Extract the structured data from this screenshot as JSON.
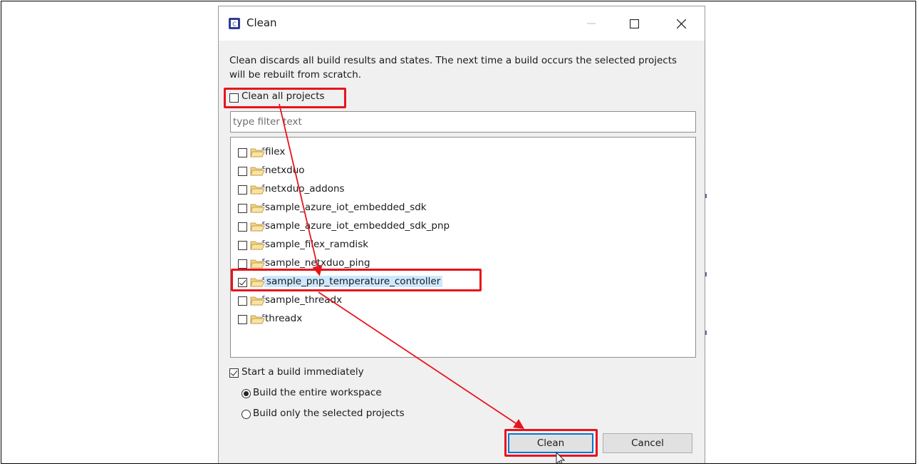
{
  "dialog": {
    "title": "Clean",
    "description": "Clean discards all build results and states. The next time a build occurs the selected projects will be rebuilt from scratch.",
    "clean_all_label": "Clean all projects",
    "clean_all_checked": false,
    "filter_placeholder": "type filter text",
    "projects": [
      {
        "name": "filex",
        "checked": false
      },
      {
        "name": "netxduo",
        "checked": false
      },
      {
        "name": "netxduo_addons",
        "checked": false
      },
      {
        "name": "sample_azure_iot_embedded_sdk",
        "checked": false
      },
      {
        "name": "sample_azure_iot_embedded_sdk_pnp",
        "checked": false
      },
      {
        "name": "sample_filex_ramdisk",
        "checked": false
      },
      {
        "name": "sample_netxduo_ping",
        "checked": false
      },
      {
        "name": "sample_pnp_temperature_controller",
        "checked": true
      },
      {
        "name": "sample_threadx",
        "checked": false
      },
      {
        "name": "threadx",
        "checked": false
      }
    ],
    "start_build_label": "Start a build immediately",
    "start_build_checked": true,
    "build_options": [
      {
        "label": "Build the entire workspace",
        "selected": true
      },
      {
        "label": "Build only the selected projects",
        "selected": false
      }
    ],
    "clean_button": "Clean",
    "cancel_button": "Cancel"
  },
  "colors": {
    "highlight": "#e8141c",
    "selection": "#cce8ff",
    "focus_border": "#0078d7"
  }
}
